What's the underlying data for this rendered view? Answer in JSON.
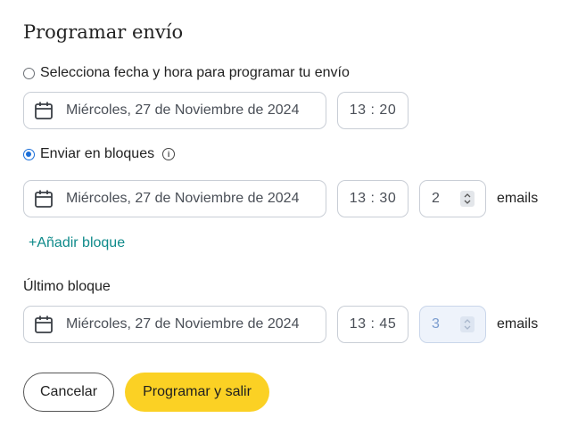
{
  "title": "Programar envío",
  "schedule_option": {
    "label": "Selecciona fecha y hora para programar tu envío",
    "selected": false,
    "date": "Miércoles, 27 de Noviembre de 2024",
    "time": "13 : 20"
  },
  "blocks_option": {
    "label": "Enviar en bloques",
    "selected": true,
    "blocks": [
      {
        "date": "Miércoles, 27 de Noviembre de 2024",
        "time": "13 : 30",
        "count": "2",
        "suffix": "emails"
      }
    ],
    "add_block_label": "+Añadir bloque"
  },
  "last_block": {
    "label": "Último bloque",
    "date": "Miércoles, 27 de Noviembre de 2024",
    "time": "13 : 45",
    "count": "3",
    "suffix": "emails"
  },
  "actions": {
    "cancel_label": "Cancelar",
    "submit_label": "Programar y salir"
  },
  "colors": {
    "accent": "#fbd124",
    "radio_selected": "#1a6ed8",
    "link": "#0e8a8a",
    "disabled_bg": "#eef3fb"
  },
  "icons": [
    "calendar-icon",
    "info-icon",
    "stepper-icon"
  ]
}
